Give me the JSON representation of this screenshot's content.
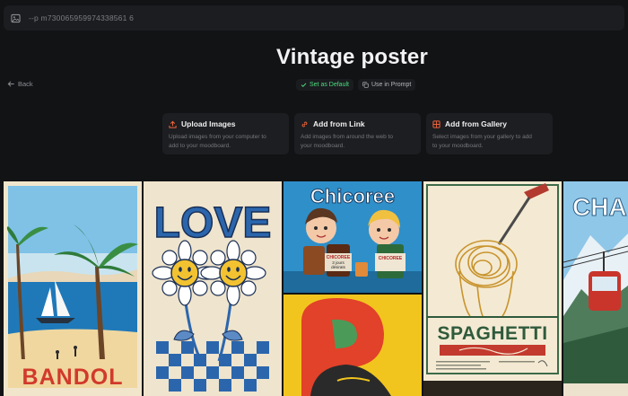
{
  "prompt_bar": {
    "text": "--p m730065959974338561 6",
    "icon": "image-icon"
  },
  "back": {
    "label": "Back",
    "icon": "arrow-left-icon"
  },
  "title": "Vintage poster",
  "actions": {
    "set_default": {
      "label": "Set as Default",
      "icon": "check-icon",
      "color": "#4ade80"
    },
    "use_in_prompt": {
      "label": "Use in Prompt",
      "icon": "copy-icon"
    }
  },
  "cards": [
    {
      "title": "Upload Images",
      "desc_1": "Upload images from your computer to",
      "desc_2": "add to your moodboard.",
      "icon": "upload-icon",
      "color": "#f0643c"
    },
    {
      "title": "Add from Link",
      "desc_1": "Add images from around the web to",
      "desc_2": "your moodboard.",
      "icon": "link-icon",
      "color": "#f0643c"
    },
    {
      "title": "Add from Gallery",
      "desc_1": "Select images from your gallery to add",
      "desc_2": "to your moodboard.",
      "icon": "gallery-icon",
      "color": "#f0643c"
    }
  ],
  "posters": {
    "bandol": {
      "text": "BANDOL"
    },
    "love": {
      "text": "LOVE"
    },
    "chicoree": {
      "text": "Chicoree",
      "jar1": "CHICOREE",
      "jar1_sub": "3 jours",
      "jar1_sub2": "désirats",
      "jar2": "CHICOREE"
    },
    "spaghetti": {
      "text": "SPAGHETTI"
    },
    "cham": {
      "text": "CHAM"
    }
  }
}
